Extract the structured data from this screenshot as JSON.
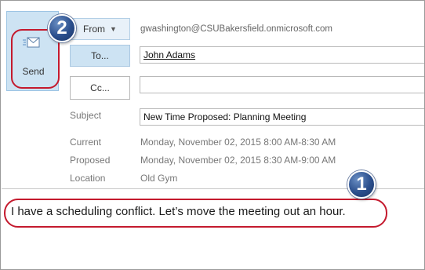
{
  "send": {
    "label": "Send"
  },
  "from": {
    "label": "From",
    "value": "gwashington@CSUBakersfield.onmicrosoft.com"
  },
  "to": {
    "label": "To...",
    "value": "John Adams"
  },
  "cc": {
    "label": "Cc...",
    "value": ""
  },
  "subject": {
    "label": "Subject",
    "value": "New Time Proposed: Planning Meeting"
  },
  "current": {
    "label": "Current",
    "value": "Monday, November 02, 2015 8:00 AM-8:30 AM"
  },
  "proposed": {
    "label": "Proposed",
    "value": "Monday, November 02, 2015 8:30 AM-9:00 AM"
  },
  "location": {
    "label": "Location",
    "value": "Old Gym"
  },
  "body": {
    "text": "I have a scheduling conflict. Let’s move the meeting out an hour."
  },
  "badges": {
    "one": "1",
    "two": "2"
  },
  "colors": {
    "highlight_ring": "#c41a2e",
    "button_blue": "#cde3f3",
    "badge_blue": "#2a4e8c"
  }
}
